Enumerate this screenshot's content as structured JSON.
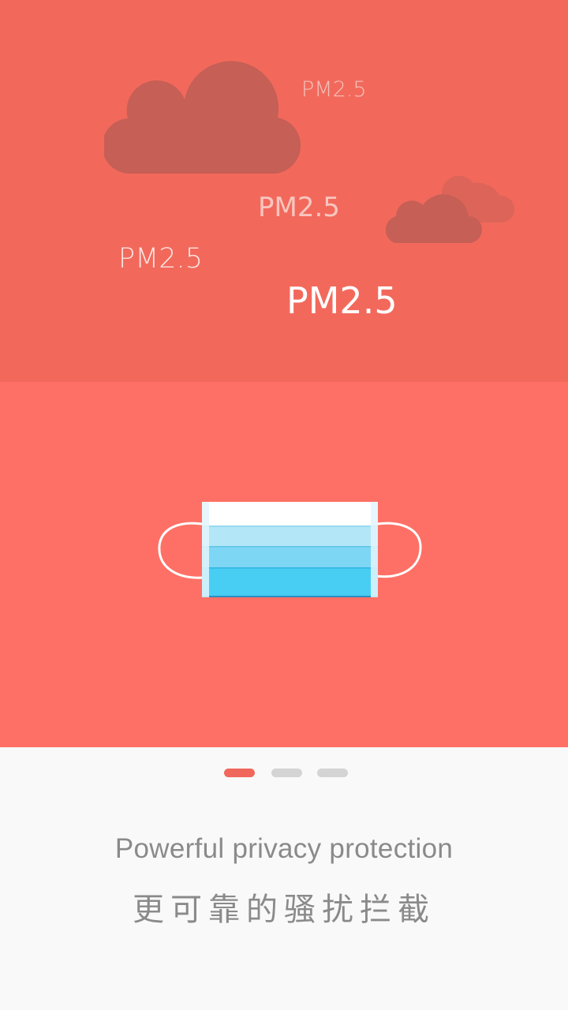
{
  "illustration": {
    "pm_labels": [
      "PM2.5",
      "PM2.5",
      "PM2.5",
      "PM2.5"
    ],
    "colors": {
      "top_background": "#f2695c",
      "middle_background": "#fe7065",
      "cloud_dark": "#c65f55",
      "cloud_light": "#dd6459",
      "mask_blue_light": "#b3e7f7",
      "mask_blue_mid": "#7ed6f5",
      "mask_blue_dark": "#48cdf3"
    },
    "icons": [
      "cloud-icon",
      "face-mask-icon"
    ]
  },
  "pager": {
    "page_count": 3,
    "current_page": 1
  },
  "caption": {
    "title_en": "Powerful privacy protection",
    "title_zh": "更可靠的骚扰拦截"
  }
}
